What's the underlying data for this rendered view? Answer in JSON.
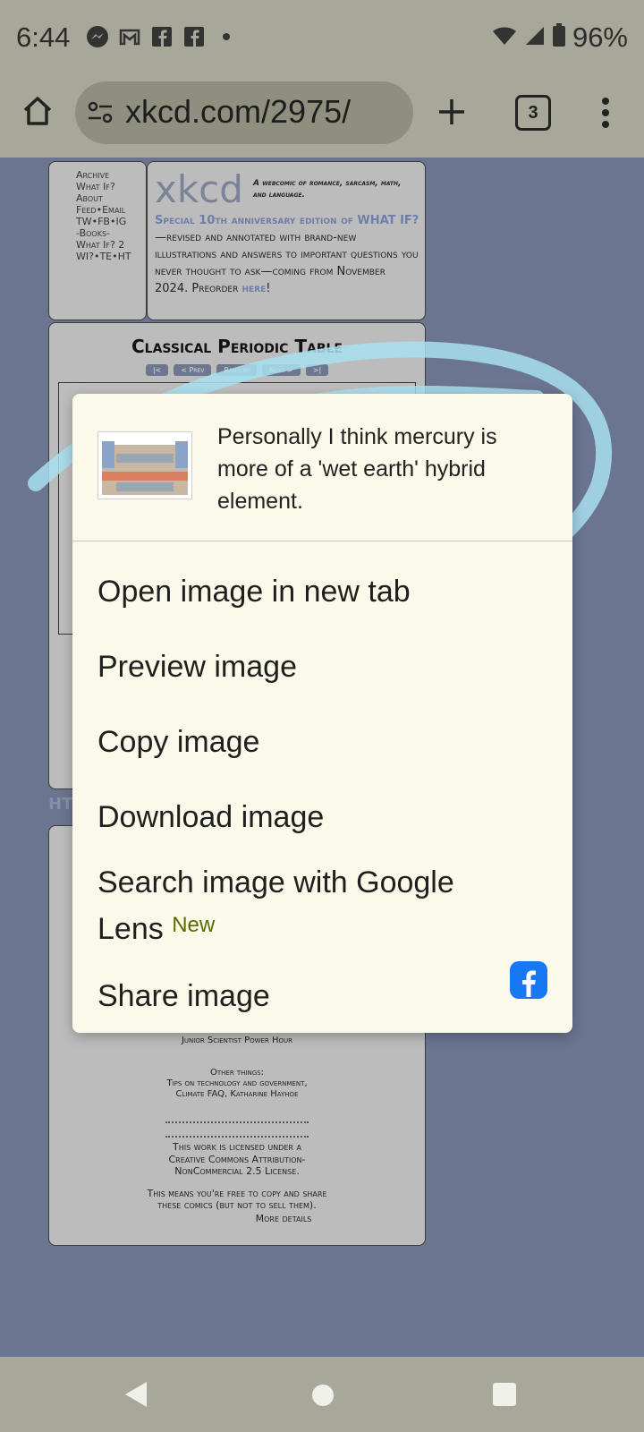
{
  "status_bar": {
    "time": "6:44",
    "battery": "96%",
    "notification_icons": [
      "messenger-icon",
      "gmail-icon",
      "facebook-icon",
      "facebook-icon"
    ]
  },
  "browser": {
    "url": "xkcd.com/2975/",
    "tab_count": "3"
  },
  "site": {
    "nav_links": [
      "Archive",
      "What If?",
      "About",
      "Feed•Email",
      "TW•FB•IG",
      "-Books-",
      "What If? 2",
      "WI?•TE•HT"
    ],
    "logo": "xkcd",
    "tagline": "A webcomic of romance, sarcasm, math, and language.",
    "promo_highlight": "Special 10th anniversary edition of WHAT IF?",
    "promo_text": "—revised and annotated with brand-new illustrations and answers to important questions you never thought to ask—coming from November 2024. Preorder",
    "promo_link": "here",
    "promo_end": "!",
    "comic_title": "Classical Periodic Table",
    "comic_nav": [
      "|<",
      "< Prev",
      "Random",
      "Next >",
      ">|"
    ],
    "partial_heading": "HT",
    "footer": {
      "junior": "Junior Scientist Power Hour",
      "other_label": "Other things:",
      "other_links": "Tips on technology and government,",
      "other_links2": "Climate FAQ, Katharine Hayhoe",
      "license_intro": "This work is licensed under a",
      "license_link": "Creative Commons Attribution-NonCommercial 2.5 License",
      "license_tail": ".",
      "free_text": "This means you're free to copy and share these comics (but not to sell them).",
      "more_details": "More details"
    }
  },
  "context_menu": {
    "caption": "Personally I think mercury is more of a 'wet earth' hybrid element.",
    "items": [
      {
        "label": "Open image in new tab"
      },
      {
        "label": "Preview image"
      },
      {
        "label": "Copy image"
      },
      {
        "label": "Download image"
      },
      {
        "label": "Search image with Google Lens",
        "badge": "New"
      },
      {
        "label": "Share image"
      }
    ]
  },
  "colors": {
    "page_bg": "#6b7590",
    "menu_bg": "#fbf9ea",
    "annotation": "#a8e0f0",
    "facebook_blue": "#1877f2"
  }
}
